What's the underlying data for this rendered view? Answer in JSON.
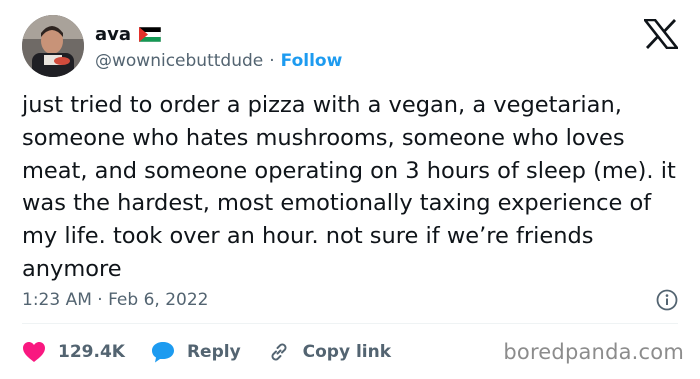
{
  "user": {
    "display_name": "ava",
    "handle": "@wownicebuttdude",
    "separator": "·",
    "follow_label": "Follow",
    "flag_icon": "palestine-flag-icon"
  },
  "tweet": {
    "text": "just tried to order a pizza with a vegan, a vegetarian, someone who hates mushrooms, someone who loves meat, and someone operating on 3 hours of sleep (me). it was the hardest, most emotionally taxing experience of my life. took over an hour. not sure if we’re friends anymore",
    "timestamp": "1:23 AM · Feb 6, 2022"
  },
  "actions": {
    "likes": "129.4K",
    "reply_label": "Reply",
    "copy_link_label": "Copy link"
  },
  "watermark": "boredpanda.com",
  "colors": {
    "accent": "#1d9bf0",
    "like": "#f91880",
    "secondary_text": "#536471",
    "primary_text": "#0f1419"
  }
}
